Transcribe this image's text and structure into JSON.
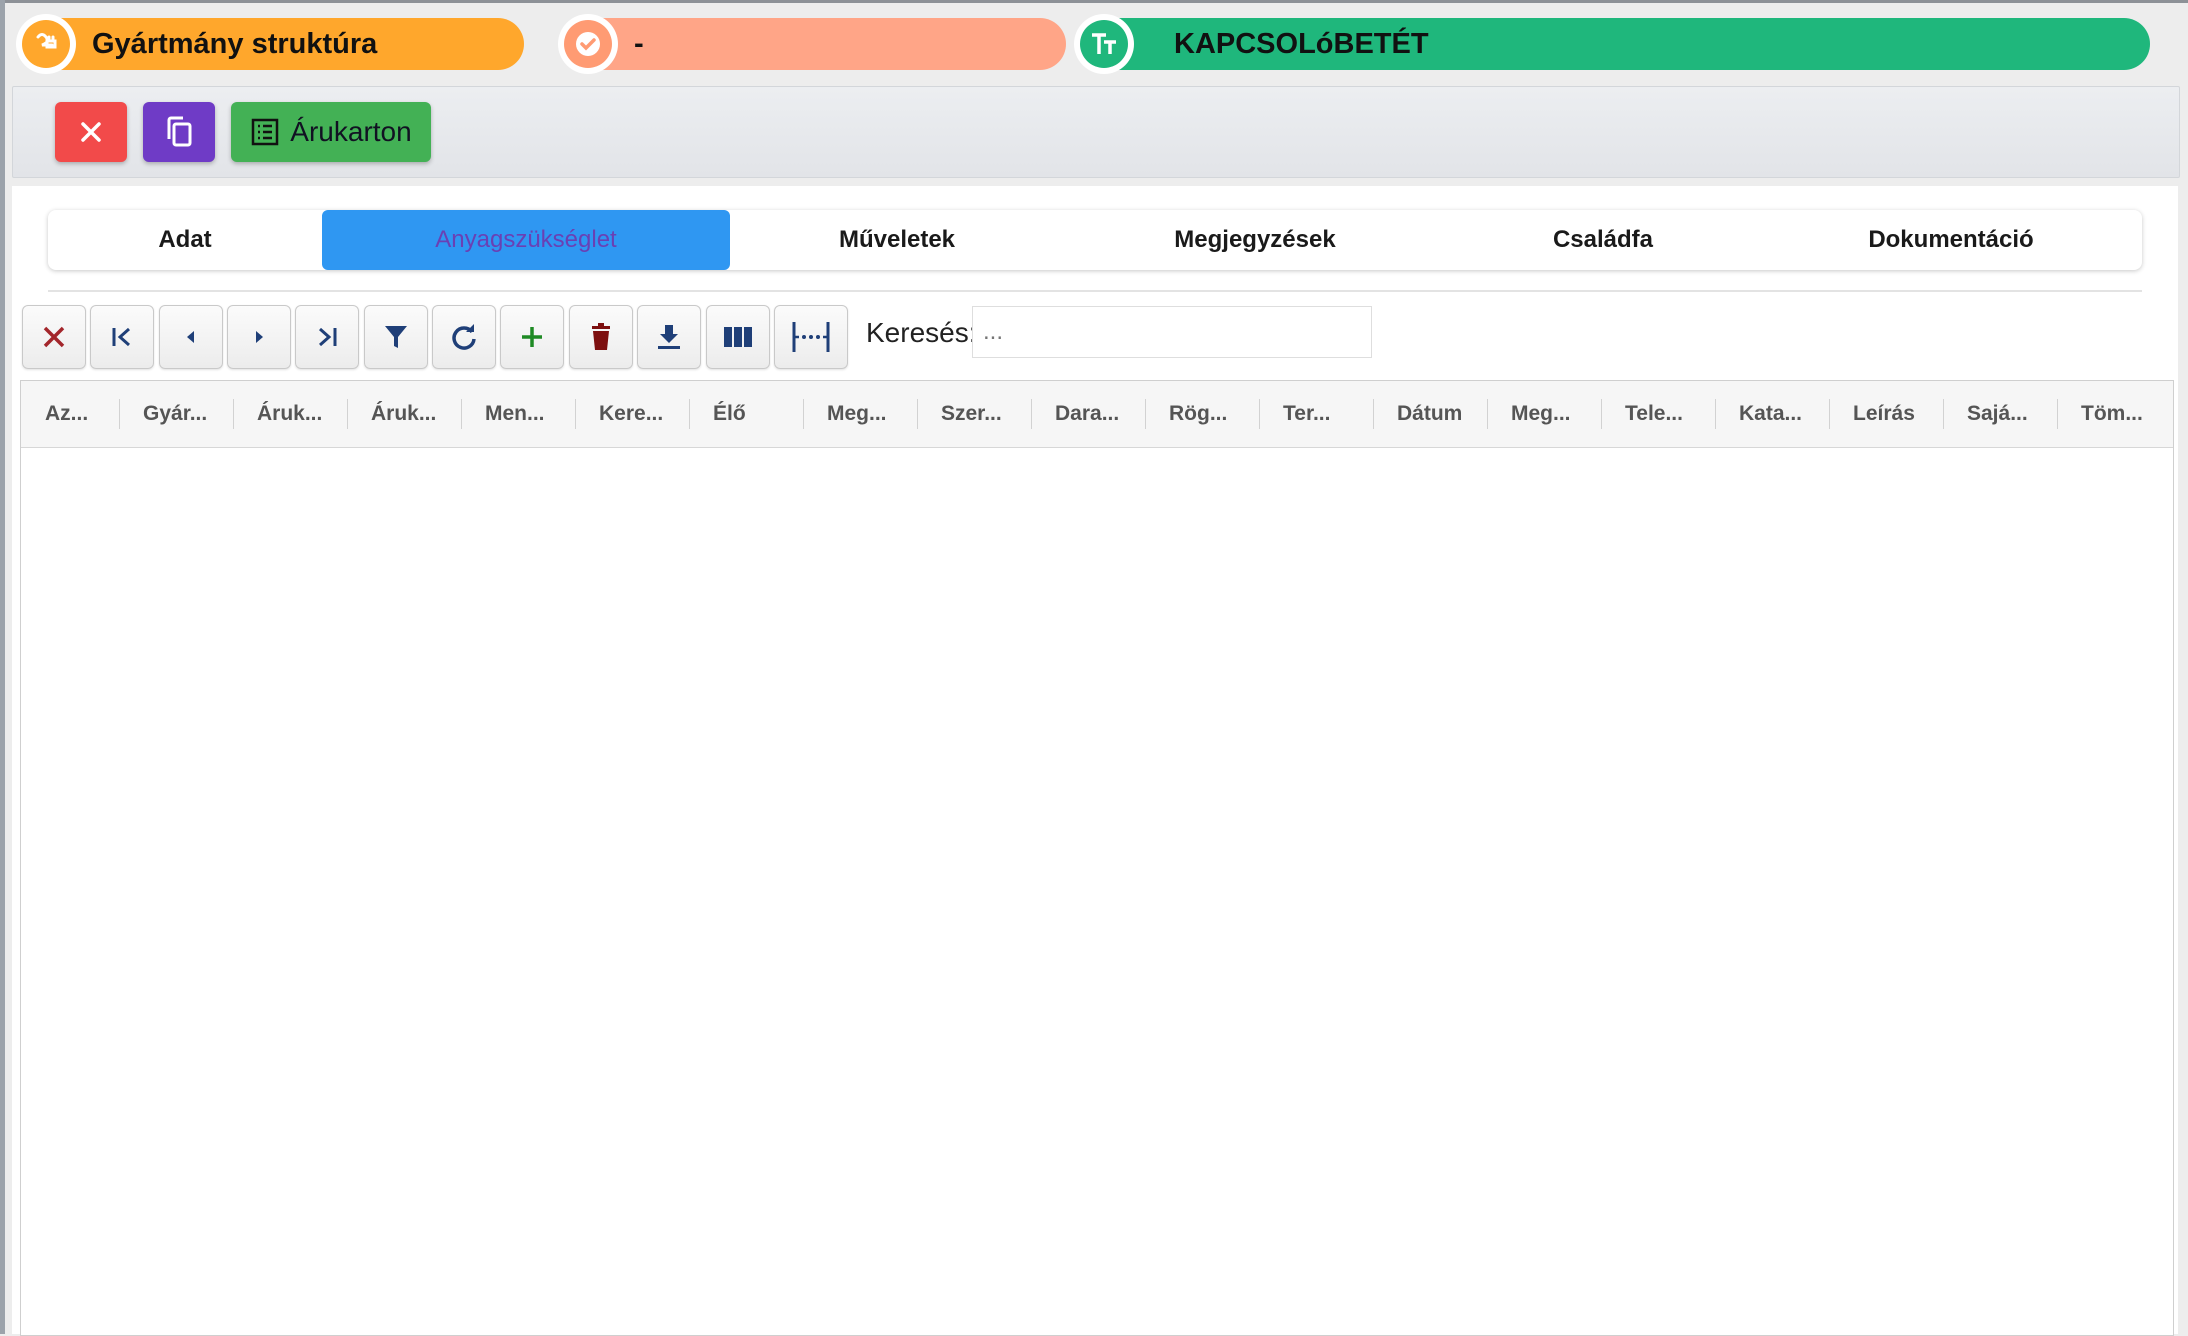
{
  "header": {
    "pill1": {
      "label": "Gyártmány struktúra",
      "icon": "plug-icon",
      "color": "#ffa72c"
    },
    "pill2": {
      "label": "-",
      "icon": "badge-check-icon",
      "color": "#ffa587"
    },
    "pill3": {
      "label": "KAPCSOLóBETÉT",
      "icon": "text-size-icon",
      "color": "#1fb77c"
    }
  },
  "actions": {
    "close_icon": "close-icon",
    "copy_icon": "copy-icon",
    "card_label": "Árukarton",
    "card_icon": "list-icon"
  },
  "tabs": [
    {
      "label": "Adat",
      "active": false
    },
    {
      "label": "Anyagszükséglet",
      "active": true
    },
    {
      "label": "Műveletek",
      "active": false
    },
    {
      "label": "Megjegyzések",
      "active": false
    },
    {
      "label": "Családfa",
      "active": false
    },
    {
      "label": "Dokumentáció",
      "active": false
    }
  ],
  "grid_toolbar": {
    "buttons": [
      "clear-icon",
      "first-page-icon",
      "prev-icon",
      "next-icon",
      "last-page-icon",
      "filter-icon",
      "refresh-icon",
      "add-icon",
      "delete-icon",
      "download-icon",
      "columns-icon",
      "fit-columns-icon"
    ],
    "search_label": "Keresés:",
    "search_placeholder": "..."
  },
  "grid": {
    "columns": [
      "Az...",
      "Gyár...",
      "Áruk...",
      "Áruk...",
      "Men...",
      "Kere...",
      "Élő",
      "Meg...",
      "Szer...",
      "Dara...",
      "Rög...",
      "Ter...",
      "Dátum",
      "Meg...",
      "Tele...",
      "Kata...",
      "Leírás",
      "Sajá...",
      "Töm..."
    ],
    "rows": []
  }
}
